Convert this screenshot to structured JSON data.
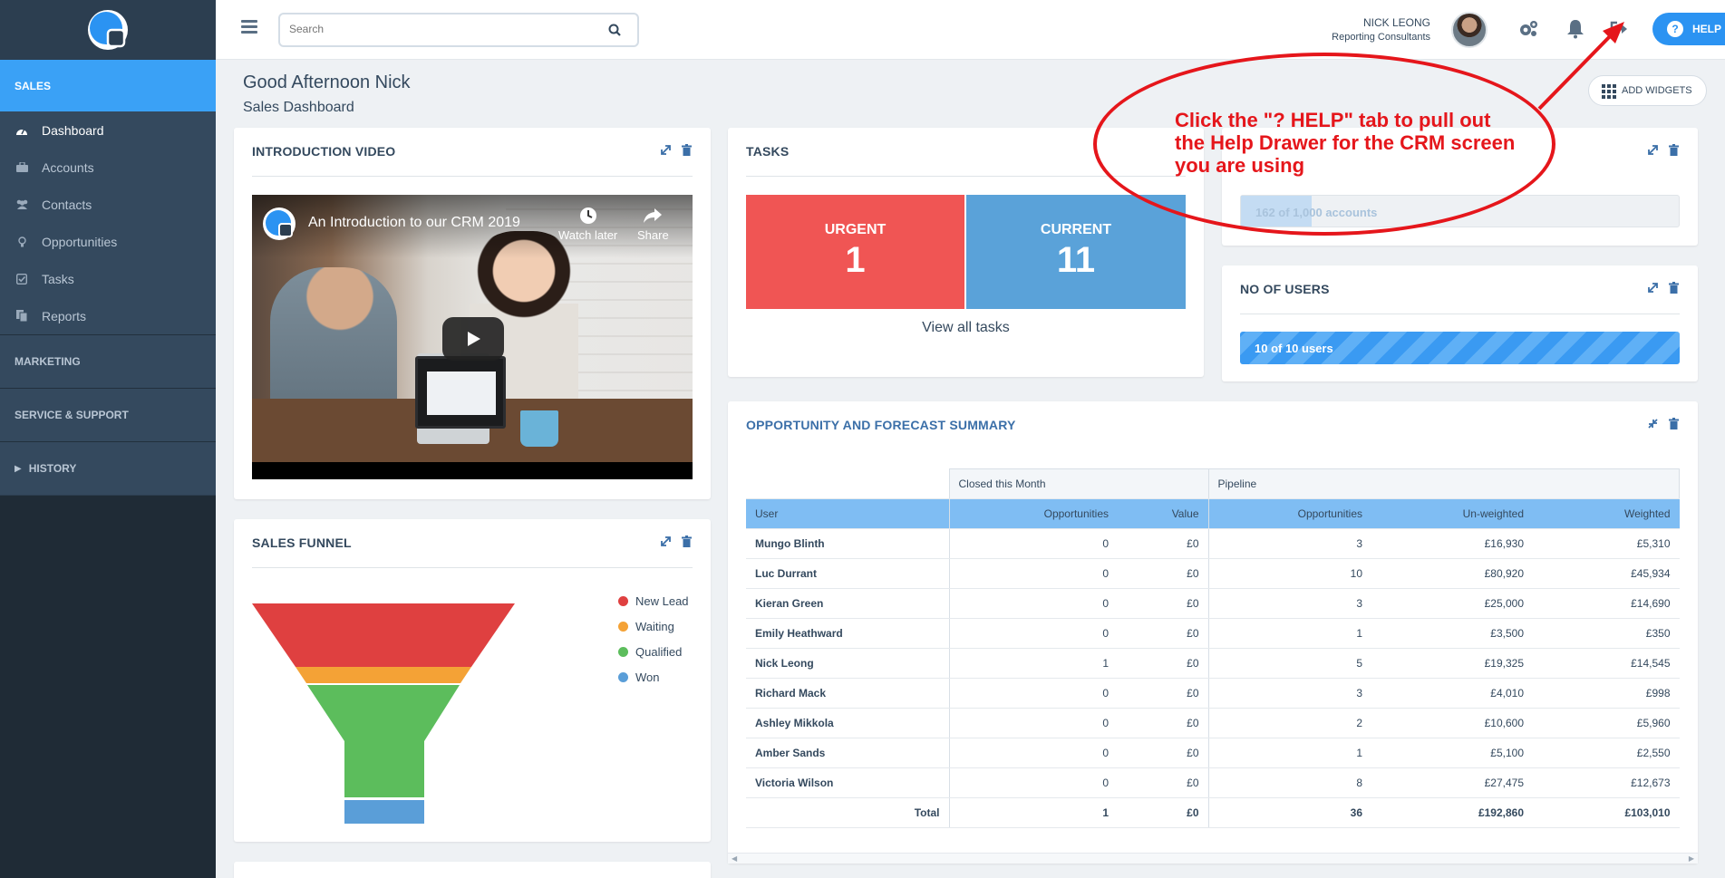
{
  "search": {
    "placeholder": "Search"
  },
  "user": {
    "name": "NICK LEONG",
    "role": "Reporting Consultants"
  },
  "help_label": "HELP",
  "sidebar": {
    "section": "SALES",
    "items": [
      {
        "label": "Dashboard",
        "icon": "dashboard-icon",
        "active": true
      },
      {
        "label": "Accounts",
        "icon": "briefcase-icon"
      },
      {
        "label": "Contacts",
        "icon": "users-icon"
      },
      {
        "label": "Opportunities",
        "icon": "lightbulb-icon"
      },
      {
        "label": "Tasks",
        "icon": "checkbox-icon"
      },
      {
        "label": "Reports",
        "icon": "report-icon"
      }
    ],
    "groups": [
      "MARKETING",
      "SERVICE & SUPPORT",
      "HISTORY"
    ]
  },
  "greeting": "Good Afternoon Nick",
  "subtitle": "Sales Dashboard",
  "add_widgets": "ADD WIDGETS",
  "intro_video": {
    "title": "INTRODUCTION VIDEO",
    "video_title": "An Introduction to our CRM 2019",
    "watch_later": "Watch later",
    "share": "Share"
  },
  "sales_funnel": {
    "title": "SALES FUNNEL",
    "legend": [
      {
        "label": "New Lead",
        "color": "#df4040"
      },
      {
        "label": "Waiting",
        "color": "#f4a236"
      },
      {
        "label": "Qualified",
        "color": "#5cbd5c"
      },
      {
        "label": "Won",
        "color": "#5a9ed8"
      }
    ]
  },
  "tasks": {
    "title": "TASKS",
    "urgent_label": "URGENT",
    "urgent_count": "1",
    "current_label": "CURRENT",
    "current_count": "11",
    "urgent_color": "#f05554",
    "current_color": "#5aa2d9",
    "view_all": "View all tasks"
  },
  "accounts_widget": {
    "progress_label": "162 of 1,000 accounts",
    "fraction": 0.162
  },
  "users_widget": {
    "title": "NO OF USERS",
    "progress_label": "10 of 10 users",
    "fraction": 1.0
  },
  "opportunity": {
    "title": "OPPORTUNITY AND FORECAST SUMMARY",
    "group_headers": [
      "Closed this Month",
      "Pipeline"
    ],
    "columns": [
      "User",
      "Opportunities",
      "Value",
      "Opportunities",
      "Un-weighted",
      "Weighted"
    ],
    "rows": [
      [
        "Mungo Blinth",
        "0",
        "£0",
        "3",
        "£16,930",
        "£5,310"
      ],
      [
        "Luc Durrant",
        "0",
        "£0",
        "10",
        "£80,920",
        "£45,934"
      ],
      [
        "Kieran Green",
        "0",
        "£0",
        "3",
        "£25,000",
        "£14,690"
      ],
      [
        "Emily Heathward",
        "0",
        "£0",
        "1",
        "£3,500",
        "£350"
      ],
      [
        "Nick Leong",
        "1",
        "£0",
        "5",
        "£19,325",
        "£14,545"
      ],
      [
        "Richard Mack",
        "0",
        "£0",
        "3",
        "£4,010",
        "£998"
      ],
      [
        "Ashley Mikkola",
        "0",
        "£0",
        "2",
        "£10,600",
        "£5,960"
      ],
      [
        "Amber Sands",
        "0",
        "£0",
        "1",
        "£5,100",
        "£2,550"
      ],
      [
        "Victoria Wilson",
        "0",
        "£0",
        "8",
        "£27,475",
        "£12,673"
      ]
    ],
    "total": [
      "Total",
      "1",
      "£0",
      "36",
      "£192,860",
      "£103,010"
    ]
  },
  "annotation": {
    "text": "Click the \"? HELP\" tab to pull out the Help Drawer for the CRM screen you are using",
    "color": "#e5161b"
  }
}
